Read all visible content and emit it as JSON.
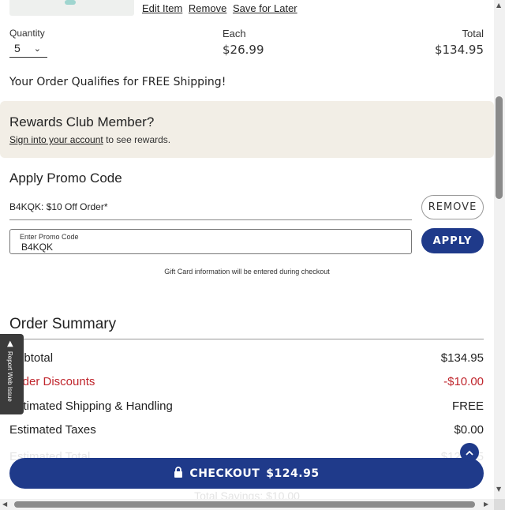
{
  "item": {
    "links": [
      "Edit Item",
      "Remove",
      "Save for Later"
    ],
    "quantity_label": "Quantity",
    "quantity_value": "5",
    "each_label": "Each",
    "each_value": "$26.99",
    "total_label": "Total",
    "total_value": "$134.95"
  },
  "free_shipping": "Your Order Qualifies for FREE Shipping!",
  "rewards": {
    "title": "Rewards Club Member?",
    "link": "Sign into your account",
    "suffix": " to see rewards."
  },
  "promo": {
    "title": "Apply Promo Code",
    "applied_code": "B4KQK: $10 Off Order*",
    "remove_label": "REMOVE",
    "input_label": "Enter Promo Code",
    "input_value": "B4KQK",
    "apply_label": "APPLY",
    "gift_note": "Gift Card information will be entered during checkout"
  },
  "summary": {
    "title": "Order Summary",
    "rows": [
      {
        "label": "Subtotal",
        "value": "$134.95"
      },
      {
        "label": "Order Discounts",
        "value": "-$10.00"
      },
      {
        "label": "Estimated Shipping & Handling",
        "value": "FREE"
      },
      {
        "label": "Estimated Taxes",
        "value": "$0.00"
      },
      {
        "label": "Estimated Total",
        "value": "$124.95"
      }
    ]
  },
  "report_tab": "Report Web Issue",
  "checkout": {
    "label": "CHECKOUT",
    "amount": "$124.95"
  },
  "savings": "Total Savings: $10.00",
  "colors": {
    "brand": "#1f3a8a",
    "discount": "#c0262d",
    "rewards_bg": "#f2eee6"
  }
}
